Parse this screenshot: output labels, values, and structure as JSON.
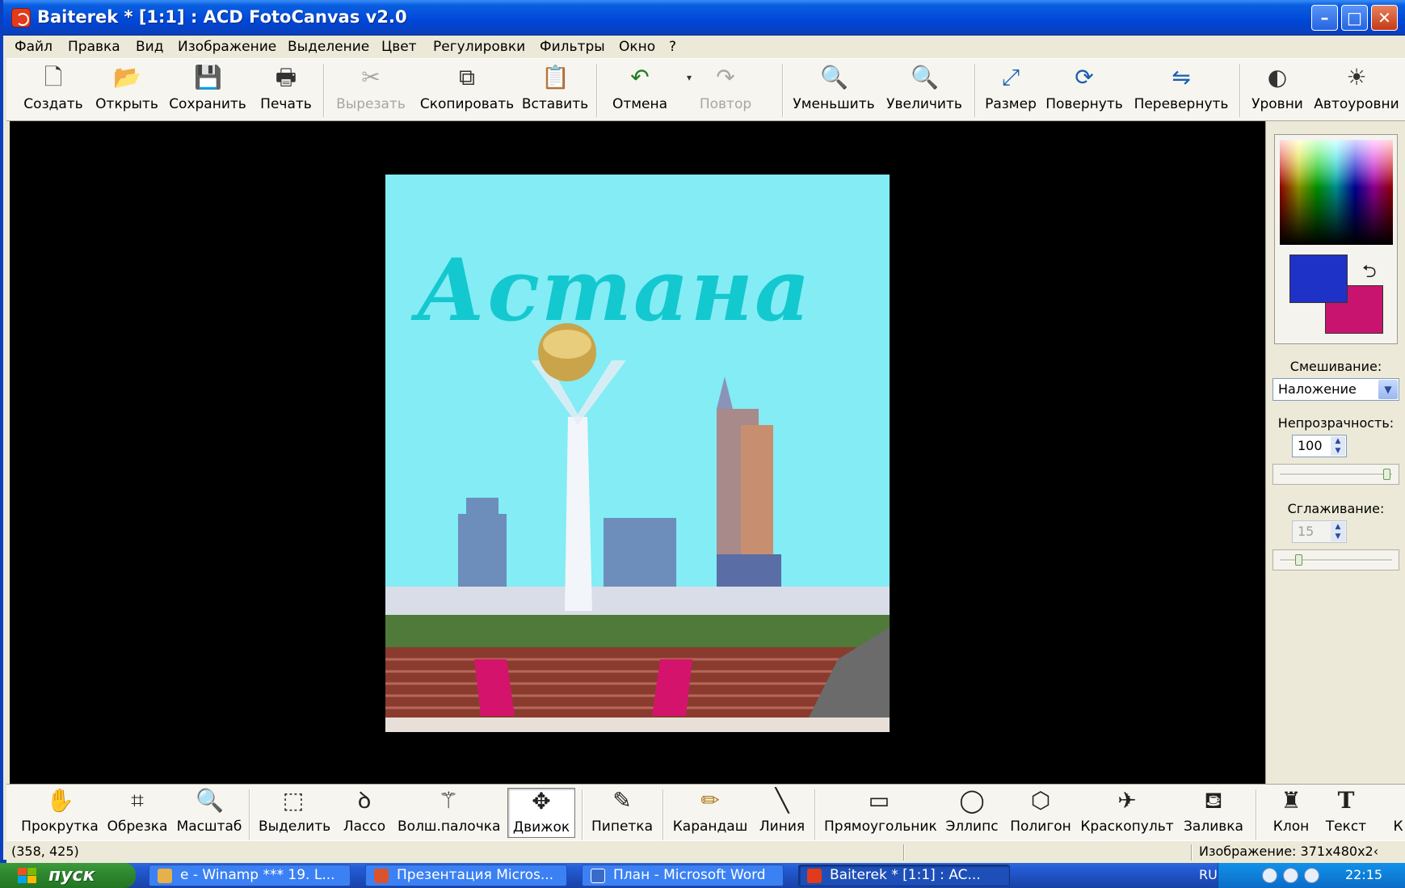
{
  "window": {
    "title": "Baiterek * [1:1] : ACD FotoCanvas v2.0",
    "controls": {
      "minimize": "–",
      "maximize": "□",
      "close": "✕"
    }
  },
  "menu": [
    "Файл",
    "Правка",
    "Вид",
    "Изображение",
    "Выделение",
    "Цвет",
    "Регулировки",
    "Фильтры",
    "Окно",
    "?"
  ],
  "toolbar": [
    {
      "label": "Создать",
      "icon": "new-document-icon",
      "glyph": "🗋",
      "enabled": true
    },
    {
      "label": "Открыть",
      "icon": "open-folder-icon",
      "glyph": "📂",
      "enabled": true
    },
    {
      "label": "Сохранить",
      "icon": "save-floppy-icon",
      "glyph": "💾",
      "enabled": true
    },
    {
      "label": "Печать",
      "icon": "print-icon",
      "glyph": "🖶",
      "enabled": true
    },
    {
      "label": "Вырезать",
      "icon": "cut-icon",
      "glyph": "✂",
      "enabled": false
    },
    {
      "label": "Скопировать",
      "icon": "copy-icon",
      "glyph": "⧉",
      "enabled": true
    },
    {
      "label": "Вставить",
      "icon": "paste-icon",
      "glyph": "📋",
      "enabled": true
    },
    {
      "label": "Отмена",
      "icon": "undo-icon",
      "glyph": "↶",
      "enabled": true
    },
    {
      "label": "Повтор",
      "icon": "redo-icon",
      "glyph": "↷",
      "enabled": false
    },
    {
      "label": "Уменьшить",
      "icon": "zoom-out-icon",
      "glyph": "🔍",
      "enabled": true
    },
    {
      "label": "Увеличить",
      "icon": "zoom-in-icon",
      "glyph": "🔍",
      "enabled": true
    },
    {
      "label": "Размер",
      "icon": "resize-icon",
      "glyph": "⤢",
      "enabled": true
    },
    {
      "label": "Повернуть",
      "icon": "rotate-icon",
      "glyph": "⟳",
      "enabled": true
    },
    {
      "label": "Перевернуть",
      "icon": "flip-icon",
      "glyph": "⇋",
      "enabled": true
    },
    {
      "label": "Уровни",
      "icon": "levels-icon",
      "glyph": "◐",
      "enabled": true
    },
    {
      "label": "Автоуровни",
      "icon": "auto-levels-icon",
      "glyph": "☀",
      "enabled": true
    }
  ],
  "canvas": {
    "caption": "Астана",
    "colors": {
      "sky": "#83ecf5",
      "caption": "#14c8cf"
    }
  },
  "panel": {
    "foreground_color": "#1e32c8",
    "background_color": "#c8146e",
    "blend_label": "Смешивание:",
    "blend_value": "Наложение",
    "opacity_label": "Непрозрачность:",
    "opacity_value": "100",
    "opacity_level": 1.0,
    "smoothing_label": "Сглаживание:",
    "smoothing_value": "15",
    "smoothing_level": 0.15
  },
  "tools": [
    {
      "label": "Прокрутка",
      "icon": "hand-icon",
      "glyph": "✋"
    },
    {
      "label": "Обрезка",
      "icon": "crop-icon",
      "glyph": "⌗"
    },
    {
      "label": "Масштаб",
      "icon": "magnifier-icon",
      "glyph": "🔍"
    },
    {
      "label": "Выделить",
      "icon": "rect-select-icon",
      "glyph": "⬚"
    },
    {
      "label": "Лассо",
      "icon": "lasso-icon",
      "glyph": "ꝺ"
    },
    {
      "label": "Волш.палочка",
      "icon": "magic-wand-icon",
      "glyph": "⚚"
    },
    {
      "label": "Движок",
      "icon": "move-icon",
      "glyph": "✥",
      "active": true
    },
    {
      "label": "Пипетка",
      "icon": "eyedropper-icon",
      "glyph": "✎"
    },
    {
      "label": "Карандаш",
      "icon": "pencil-icon",
      "glyph": "✏"
    },
    {
      "label": "Линия",
      "icon": "line-icon",
      "glyph": "╲"
    },
    {
      "label": "Прямоугольник",
      "icon": "rectangle-icon",
      "glyph": "▭"
    },
    {
      "label": "Эллипс",
      "icon": "ellipse-icon",
      "glyph": "◯"
    },
    {
      "label": "Полигон",
      "icon": "polygon-icon",
      "glyph": "⬡"
    },
    {
      "label": "Краскопульт",
      "icon": "airbrush-icon",
      "glyph": "✈"
    },
    {
      "label": "Заливка",
      "icon": "paint-bucket-icon",
      "glyph": "⛾"
    },
    {
      "label": "Клон",
      "icon": "clone-stamp-icon",
      "glyph": "♜"
    },
    {
      "label": "Текст",
      "icon": "text-icon",
      "glyph": "T"
    },
    {
      "label": "К",
      "icon": "more-tools-icon",
      "glyph": ""
    }
  ],
  "status": {
    "coords": "(358, 425)",
    "image_info": "Изображение: 371x480x2‹"
  },
  "taskbar": {
    "start_label": "пуск",
    "tasks": [
      {
        "label": "e - Winamp *** 19. L...",
        "icon": "winamp-icon",
        "active": false
      },
      {
        "label": "Презентация Micros...",
        "icon": "powerpoint-icon",
        "active": false
      },
      {
        "label": "План - Microsoft Word",
        "icon": "word-icon",
        "active": false
      },
      {
        "label": "Baiterek * [1:1] : AC...",
        "icon": "fotocanvas-icon",
        "active": true
      }
    ],
    "language": "RU",
    "clock": "22:15"
  }
}
